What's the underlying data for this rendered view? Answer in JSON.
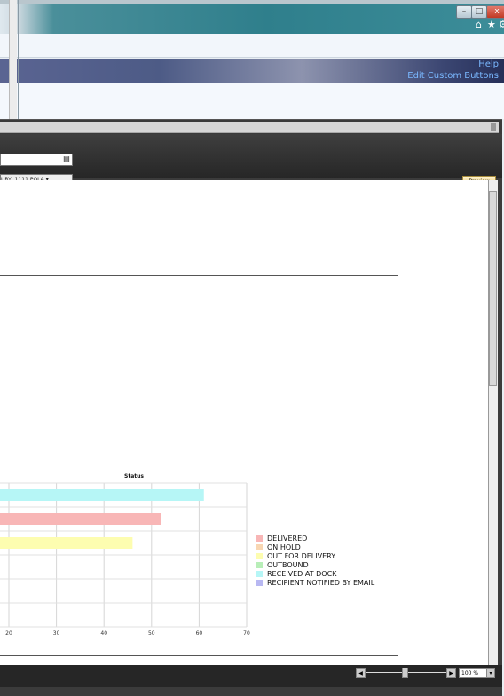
{
  "browser": {
    "window_buttons": {
      "minimize": "–",
      "maximize": "□",
      "close": "x"
    },
    "nav_icons": {
      "home": "home-icon",
      "favorites": "star-icon",
      "tools": "gear-icon"
    }
  },
  "app_header": {
    "help": "Help",
    "edit_custom_buttons": "Edit Custom Buttons"
  },
  "parameters": {
    "selected_location": "URY, 1111 POLA",
    "preview_button": "Preview"
  },
  "zoom": {
    "level": "100 %"
  },
  "chart_data": {
    "type": "bar",
    "orientation": "horizontal",
    "title": "Status",
    "xlim": [
      0,
      70
    ],
    "x_ticks": [
      "20",
      "30",
      "40",
      "50",
      "60",
      "70"
    ],
    "grid": true,
    "legend_position": "right",
    "bars": [
      {
        "series": "RECEIVED AT DOCK",
        "value": 61
      },
      {
        "series": "DELIVERED",
        "value": 52
      },
      {
        "series": "OUT FOR DELIVERY",
        "value": 46
      }
    ],
    "legend": [
      {
        "label": "DELIVERED",
        "color": "#f8b6b6"
      },
      {
        "label": "ON HOLD",
        "color": "#f8d6b2"
      },
      {
        "label": "OUT FOR DELIVERY",
        "color": "#fdfdb0"
      },
      {
        "label": "OUTBOUND",
        "color": "#b8eeb8"
      },
      {
        "label": "RECEIVED AT DOCK",
        "color": "#b6f6f6"
      },
      {
        "label": "RECIPIENT NOTIFIED BY EMAIL",
        "color": "#b8b8f2"
      }
    ]
  }
}
